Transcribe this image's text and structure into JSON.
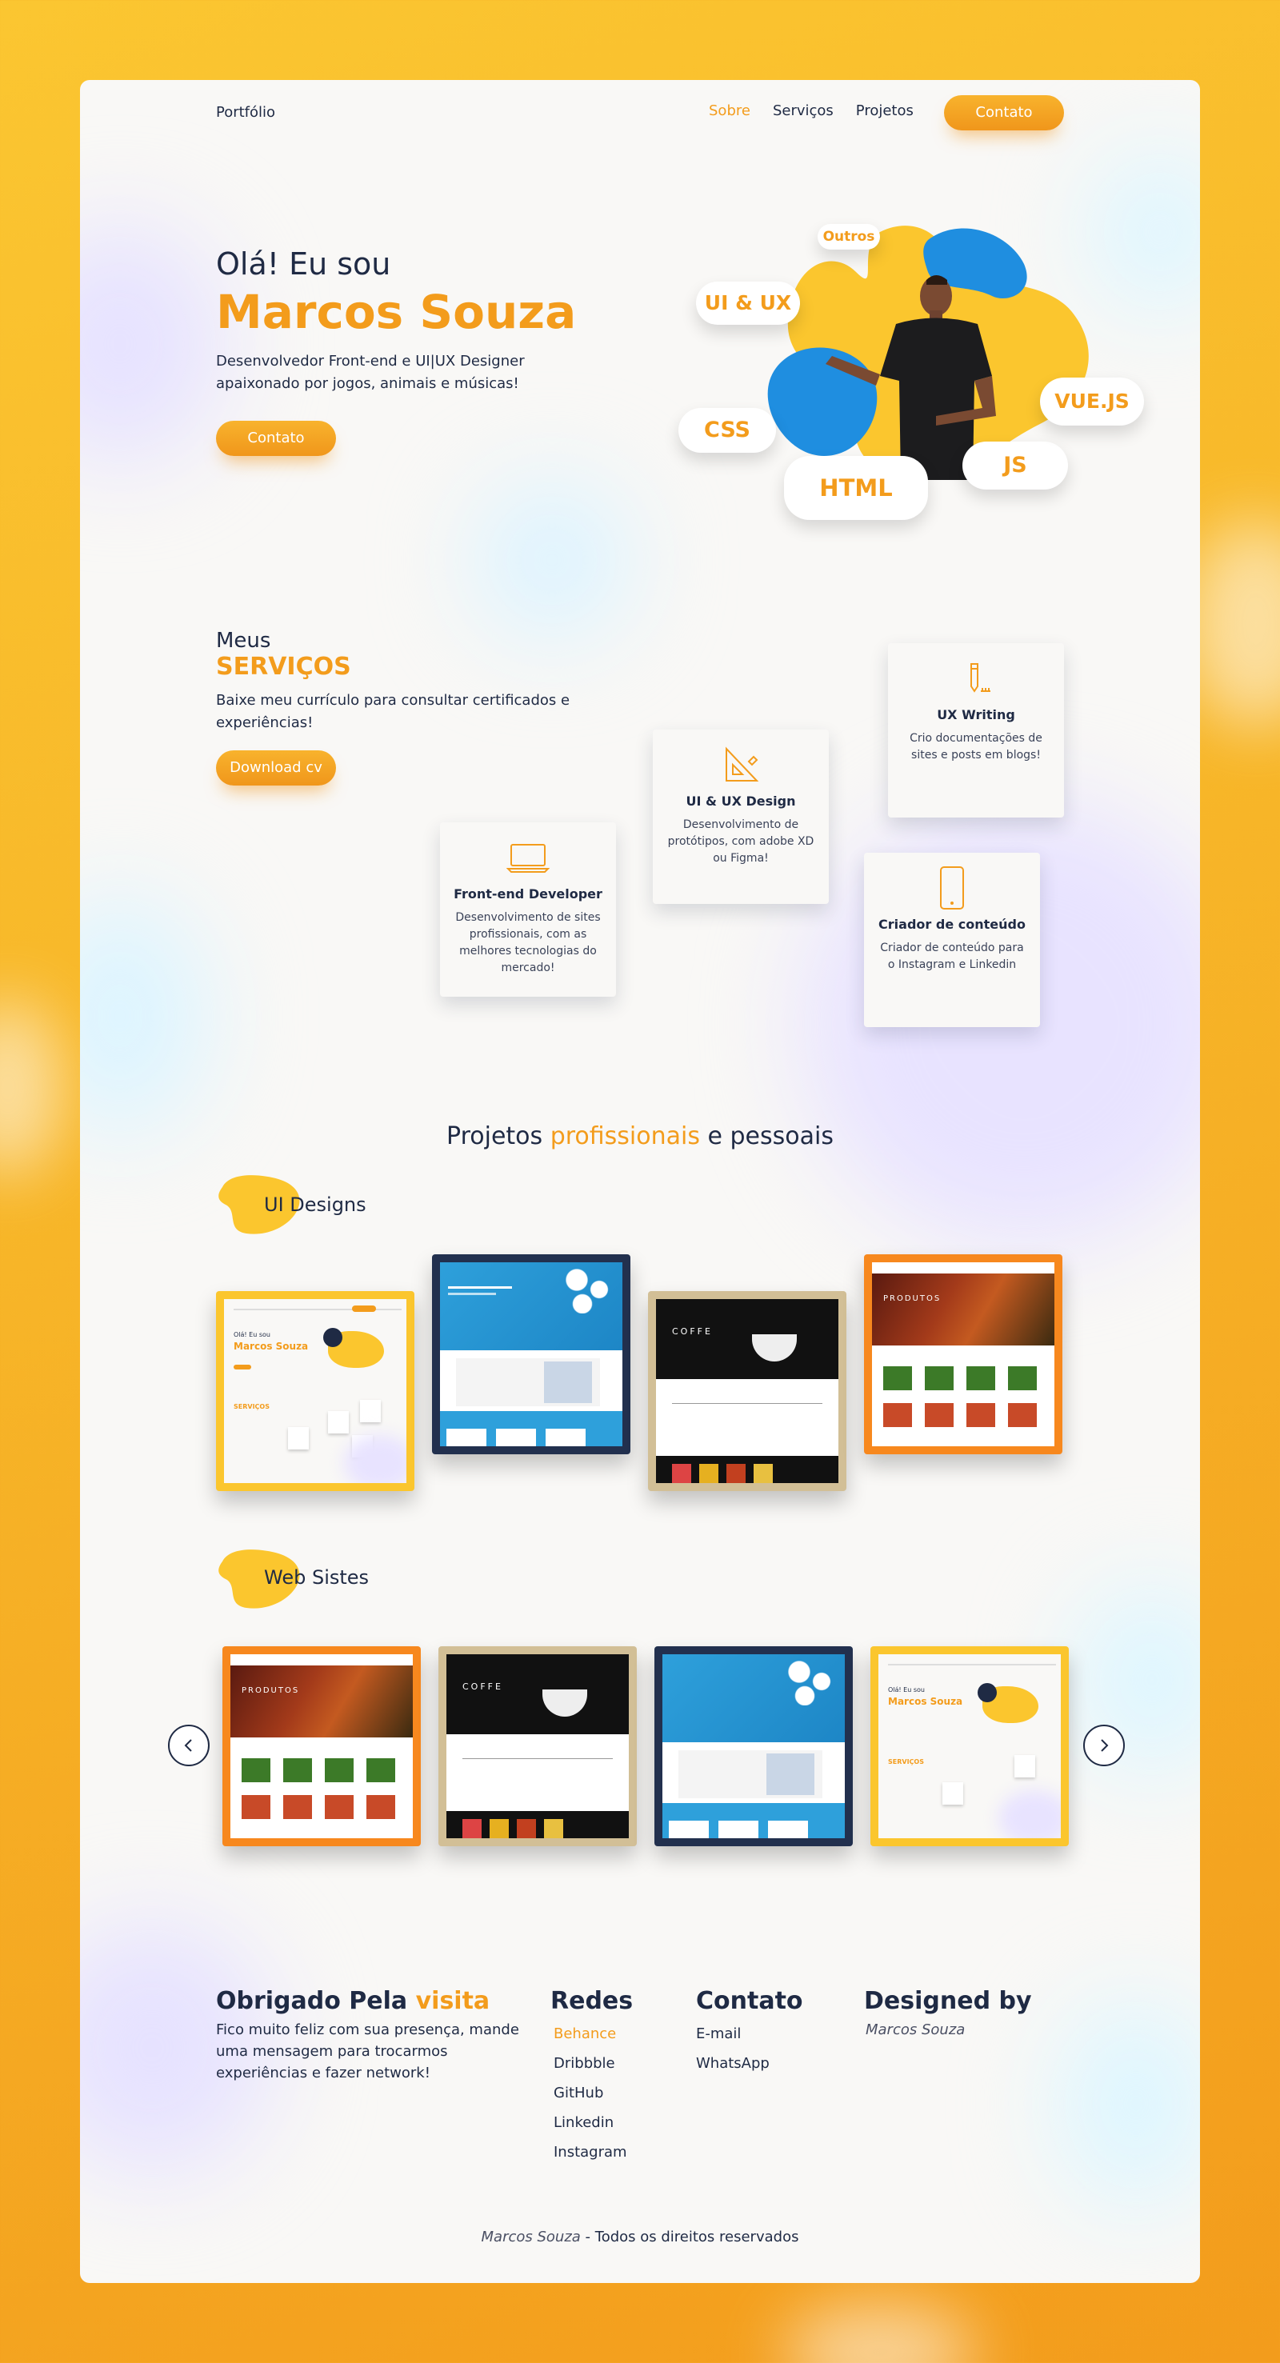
{
  "nav": {
    "brand": "Portfólio",
    "links": [
      "Sobre",
      "Serviços",
      "Projetos"
    ],
    "cta": "Contato"
  },
  "hero": {
    "greeting": "Olá! Eu sou",
    "name": "Marcos Souza",
    "description": "Desenvolvedor Front-end e UI|UX Designer apaixonado por jogos, animais e músicas!",
    "cta": "Contato",
    "tags": [
      "Outros",
      "UI & UX",
      "CSS",
      "HTML",
      "JS",
      "VUE.JS"
    ]
  },
  "services": {
    "kicker": "Meus",
    "title": "SERVIÇOS",
    "description": "Baixe meu currículo para consultar certificados e experiências!",
    "cta": "Download cv",
    "cards": [
      {
        "icon": "pencil-ruler-icon",
        "title": "UX Writing",
        "desc": "Crio documentações de sites e posts em blogs!"
      },
      {
        "icon": "set-square-icon",
        "title": "UI & UX Design",
        "desc": "Desenvolvimento de protótipos, com adobe XD ou Figma!"
      },
      {
        "icon": "laptop-icon",
        "title": "Front-end Developer",
        "desc": "Desenvolvimento de sites profissionais, com as melhores tecnologias do mercado!"
      },
      {
        "icon": "smartphone-icon",
        "title": "Criador de conteúdo",
        "desc": "Criador de conteúdo para o Instagram e Linkedin"
      }
    ]
  },
  "projects": {
    "title_start": "Projetos ",
    "title_highlight": "profissionais",
    "title_end": " e pessoais",
    "ui_label": "UI Designs",
    "web_label": "Web Sistes",
    "mini": {
      "portfolio_greet": "Olá! Eu sou",
      "portfolio_name": "Marcos Souza",
      "portfolio_services": "SERVIÇOS",
      "coffee_word": "COFFE",
      "produce_word": "PRODUTOS"
    }
  },
  "footer": {
    "thanks_start": "Obrigado Pela ",
    "thanks_highlight": "visita",
    "thanks_text": "Fico muito feliz com sua presença, mande uma mensagem para trocarmos experiências e fazer network!",
    "redes_title": "Redes",
    "redes": [
      "Behance",
      "Dribbble",
      "GitHub",
      "Linkedin",
      "Instagram"
    ],
    "contato_title": "Contato",
    "contato": [
      "E-mail",
      "WhatsApp"
    ],
    "designed_title": "Designed by",
    "designed_name": "Marcos Souza",
    "copyright_name": "Marcos Souza",
    "copyright_text": " - Todos os direitos reservados"
  },
  "colors": {
    "accent": "#f39c1c",
    "navy": "#1f2a44",
    "blue": "#1f8ee0",
    "yellow": "#fbc62e"
  }
}
